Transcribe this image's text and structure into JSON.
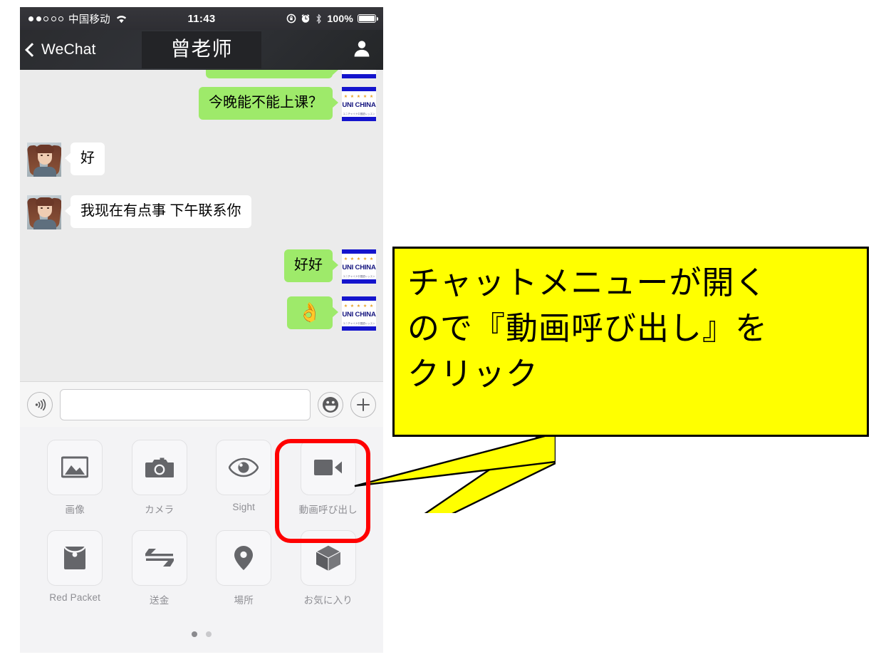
{
  "status_bar": {
    "signal_dots_filled": 2,
    "signal_dots_total": 5,
    "carrier": "中国移动",
    "wifi_icon": "wifi-icon",
    "time": "11:43",
    "rotation_lock_icon": "rotation-lock-icon",
    "alarm_icon": "alarm-clock-icon",
    "bluetooth_icon": "bluetooth-icon",
    "battery_percent": "100%"
  },
  "nav_bar": {
    "back_label": "WeChat",
    "back_icon": "chevron-left-icon",
    "title": "曾老师",
    "contact_icon": "contact-person-icon"
  },
  "messages": [
    {
      "id": "m0",
      "side": "right",
      "type": "text",
      "text": "",
      "clipped": true,
      "avatar": "uni-china"
    },
    {
      "id": "m1",
      "side": "right",
      "type": "text",
      "text": "今晚能不能上课？",
      "avatar": "uni-china"
    },
    {
      "id": "m2",
      "side": "left",
      "type": "text",
      "text": "好",
      "avatar": "girl-photo"
    },
    {
      "id": "m3",
      "side": "left",
      "type": "text",
      "text": "我现在有点事 下午联系你",
      "avatar": "girl-photo"
    },
    {
      "id": "m4",
      "side": "right",
      "type": "text",
      "text": "好好",
      "avatar": "uni-china"
    },
    {
      "id": "m5",
      "side": "right",
      "type": "emoji",
      "text": "👌",
      "avatar": "uni-china"
    }
  ],
  "avatars": {
    "uni_china_text": "UNI CHINA",
    "uni_china_stars": "★ ★ ★ ★ ★",
    "uni_china_sub": "ユニチャイナ中国語レッスン"
  },
  "input_bar": {
    "voice_icon": "voice-record-icon",
    "text_value": "",
    "text_placeholder": "",
    "emoji_icon": "smiley-face-icon",
    "plus_icon": "plus-icon"
  },
  "attachment_panel": {
    "items": [
      {
        "icon": "photo-icon",
        "label": "画像",
        "highlighted": false
      },
      {
        "icon": "camera-icon",
        "label": "カメラ",
        "highlighted": false
      },
      {
        "icon": "sight-eye-icon",
        "label": "Sight",
        "highlighted": false
      },
      {
        "icon": "video-call-icon",
        "label": "動画呼び出し",
        "highlighted": true
      },
      {
        "icon": "red-packet-icon",
        "label": "Red Packet",
        "highlighted": false
      },
      {
        "icon": "transfer-icon",
        "label": "送金",
        "highlighted": false
      },
      {
        "icon": "location-pin-icon",
        "label": "場所",
        "highlighted": false
      },
      {
        "icon": "favorites-box-icon",
        "label": "お気に入り",
        "highlighted": false
      }
    ],
    "page_dots": 2,
    "active_page": 1
  },
  "annotation": {
    "text": "チャットメニューが開く\nので『動画呼び出し』を\nクリック",
    "box_color": "#ffff00",
    "border_color": "#000000",
    "highlight_color": "#ff0000",
    "pointer_target": "動画呼び出し"
  }
}
